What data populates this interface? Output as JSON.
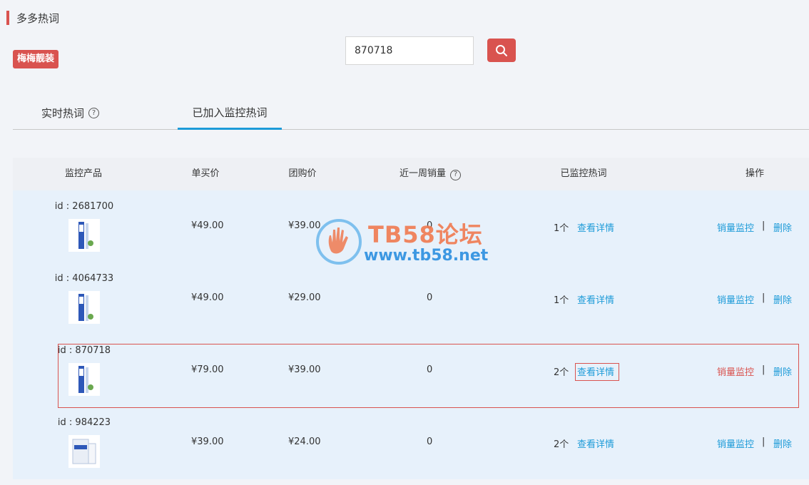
{
  "page": {
    "title": "多多热词"
  },
  "shop": {
    "name": "梅梅靓装"
  },
  "search": {
    "value": "870718"
  },
  "tabs": [
    {
      "label": "实时热词"
    },
    {
      "label": "已加入监控热词"
    }
  ],
  "table": {
    "columns": [
      "监控产品",
      "单买价",
      "团购价",
      "近一周销量",
      "已监控热词",
      "操作"
    ],
    "rows": [
      {
        "id": "id : 2681700",
        "single_price": "¥49.00",
        "group_price": "¥39.00",
        "weekly_sales": "0",
        "keyword_count": "1个"
      },
      {
        "id": "id : 4064733",
        "single_price": "¥49.00",
        "group_price": "¥29.00",
        "weekly_sales": "0",
        "keyword_count": "1个"
      },
      {
        "id": "id : 870718",
        "single_price": "¥79.00",
        "group_price": "¥39.00",
        "weekly_sales": "0",
        "keyword_count": "2个"
      },
      {
        "id": "id : 984223",
        "single_price": "¥39.00",
        "group_price": "¥24.00",
        "weekly_sales": "0",
        "keyword_count": "2个"
      }
    ],
    "actions": {
      "detail": "查看详情",
      "monitor": "销量监控",
      "separator": "|",
      "delete": "删除"
    }
  },
  "watermark": {
    "title": "TB58论坛",
    "url": "www.tb58.net"
  },
  "colors": {
    "accent": "#d9534f",
    "link": "#1d9bd8",
    "row_bg": "#e7f1fb"
  },
  "icons": {
    "search": "search-icon",
    "help": "help-circle-icon"
  }
}
